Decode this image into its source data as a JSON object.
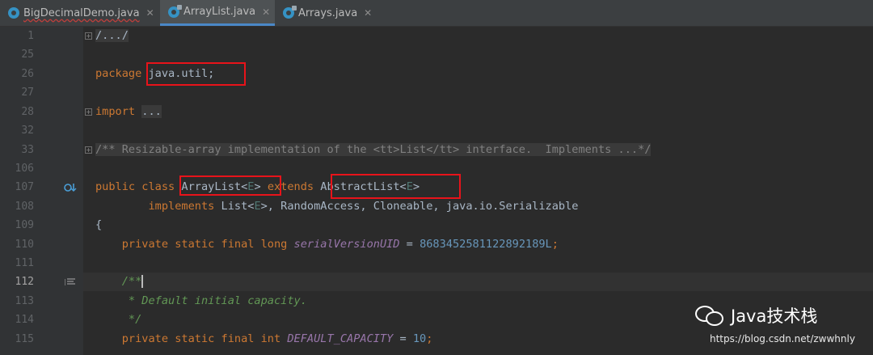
{
  "tabs": [
    {
      "label": "BigDecimalDemo.java",
      "active": false,
      "has_error": true
    },
    {
      "label": "ArrayList.java",
      "active": true,
      "has_error": false
    },
    {
      "label": "Arrays.java",
      "active": false,
      "has_error": false
    }
  ],
  "tab_close_glyph": "✕",
  "line_numbers": [
    "1",
    "25",
    "26",
    "27",
    "28",
    "32",
    "33",
    "106",
    "107",
    "108",
    "109",
    "110",
    "111",
    "112",
    "113",
    "114",
    "115"
  ],
  "current_line": "112",
  "code": {
    "l1_folded": "/.../",
    "l26_package_kw": "package",
    "l26_pkg": "java.util;",
    "l28_import_kw": "import",
    "l28_folded": "...",
    "l33_comment": "/** Resizable-array implementation of the <tt>List</tt> interface.  Implements ...*/",
    "l107_public": "public",
    "l107_class": "class",
    "l107_name": "ArrayList<",
    "l107_e1": "E",
    "l107_close1": ">",
    "l107_extends": "extends",
    "l107_super": "AbstractList<",
    "l107_e2": "E",
    "l107_close2": ">",
    "l108_implements": "implements",
    "l108_list": "List<",
    "l108_e": "E",
    "l108_rest": ">, RandomAccess, Cloneable, java.io.Serializable",
    "l109_brace": "{",
    "l110_mods": "private static final long",
    "l110_field": "serialVersionUID",
    "l110_eq": " = ",
    "l110_num": "8683452581122892189L",
    "l110_semi": ";",
    "l112_doc_open": "/**",
    "l113_doc": " * Default initial capacity.",
    "l114_doc_close": " */",
    "l115_mods": "private static final int",
    "l115_field": "DEFAULT_CAPACITY",
    "l115_eq": " = ",
    "l115_num": "10",
    "l115_semi": ";"
  },
  "watermark": {
    "title": "Java技术栈",
    "url": "https://blog.csdn.net/zwwhnly"
  },
  "colors": {
    "keyword": "#cc7832",
    "type_param": "#507874",
    "number": "#6897bb",
    "field": "#9876aa",
    "doc_comment": "#629755",
    "highlight_box": "#e8131a"
  }
}
